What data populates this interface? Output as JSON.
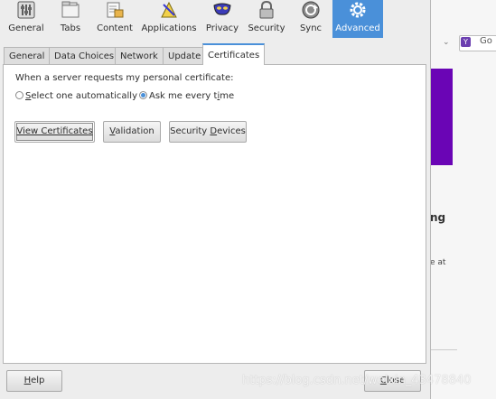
{
  "toolbar": {
    "items": [
      {
        "label": "General",
        "icon": "general-sliders-icon"
      },
      {
        "label": "Tabs",
        "icon": "tabs-icon"
      },
      {
        "label": "Content",
        "icon": "content-icon"
      },
      {
        "label": "Applications",
        "icon": "applications-icon"
      },
      {
        "label": "Privacy",
        "icon": "privacy-mask-icon"
      },
      {
        "label": "Security",
        "icon": "security-lock-icon"
      },
      {
        "label": "Sync",
        "icon": "sync-icon"
      },
      {
        "label": "Advanced",
        "icon": "advanced-gear-icon"
      }
    ],
    "active": "Advanced",
    "accent": "#4a90d9"
  },
  "tabs": {
    "items": [
      "General",
      "Data Choices",
      "Network",
      "Update",
      "Certificates"
    ],
    "active": "Certificates"
  },
  "certificates": {
    "prompt": "When a server requests my personal certificate:",
    "radio_auto": {
      "pre": "",
      "accel": "S",
      "post": "elect one automatically",
      "selected": false
    },
    "radio_ask": {
      "pre": "Ask me every t",
      "accel": "i",
      "post": "me",
      "selected": true
    },
    "view_btn": {
      "pre": "View Certificate",
      "accel": "s",
      "post": ""
    },
    "validation_btn": {
      "pre": "",
      "accel": "V",
      "post": "alidation"
    },
    "devices_btn": {
      "pre": "Security ",
      "accel": "D",
      "post": "evices"
    }
  },
  "footer": {
    "help": {
      "pre": "",
      "accel": "H",
      "post": "elp"
    },
    "close": {
      "pre": "",
      "accel": "C",
      "post": "lose"
    },
    "watermark": "https://blog.csdn.net/weixin_43478840"
  },
  "background_window": {
    "search_icon": "yahoo-search-icon",
    "search_text": "Go",
    "heading_fragment": "ng",
    "small_fragment": "e at",
    "purple": "#6a05b5"
  }
}
